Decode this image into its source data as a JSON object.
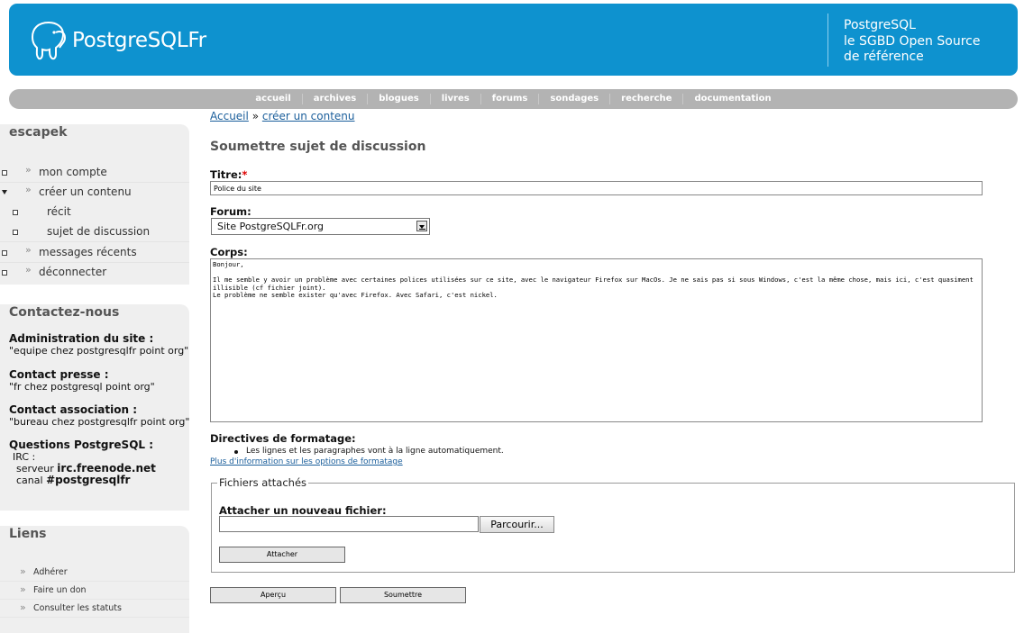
{
  "header": {
    "logo_text": "PostgreSQLFr",
    "tagline": [
      "PostgreSQL",
      "le SGBD Open Source",
      "de référence"
    ]
  },
  "nav": [
    "accueil",
    "archives",
    "blogues",
    "livres",
    "forums",
    "sondages",
    "recherche",
    "documentation"
  ],
  "sidebar": {
    "user_block": {
      "title": "escapek",
      "items": [
        {
          "label": "mon compte"
        },
        {
          "label": "créer un contenu"
        },
        {
          "label": "récit"
        },
        {
          "label": "sujet de discussion"
        },
        {
          "label": "messages récents"
        },
        {
          "label": "déconnecter"
        }
      ]
    },
    "contact_block": {
      "title": "Contactez-nous",
      "admin_heading": "Administration du site :",
      "admin_text": "\"equipe chez postgresqlfr point org\"",
      "press_heading": "Contact presse :",
      "press_text": "\"fr chez postgresql point org\"",
      "assoc_heading": "Contact association :",
      "assoc_text": "\"bureau chez postgresqlfr point org\"",
      "questions_heading": "Questions PostgreSQL :",
      "irc_label": "IRC :",
      "server_prefix": "serveur",
      "server_value": "irc.freenode.net",
      "channel_prefix": "canal",
      "channel_value": "#postgresqlfr"
    },
    "links_block": {
      "title": "Liens",
      "items": [
        "Adhérer",
        "Faire un don",
        "Consulter les statuts"
      ]
    }
  },
  "main": {
    "breadcrumb": {
      "home": "Accueil",
      "separator": "»",
      "current": "créer un contenu"
    },
    "page_title": "Soumettre sujet de discussion",
    "title_label": "Titre:",
    "title_required": "*",
    "title_value": "Police du site",
    "forum_label": "Forum:",
    "forum_selected": "Site PostgreSQLFr.org",
    "body_label": "Corps:",
    "body_value": "Bonjour,\n\nIl me semble y avoir un problème avec certaines polices utilisées sur ce site, avec le navigateur Firefox sur MacOs. Je ne sais pas si sous Windows, c'est la même chose, mais ici, c'est quasiment illisible (cf fichier joint).\nLe problème ne semble exister qu'avec Firefox. Avec Safari, c'est nickel.",
    "format_heading": "Directives de formatage:",
    "format_item": "Les lignes et les paragraphes vont à la ligne automatiquement.",
    "format_more_link": "Plus d'information sur les options de formatage",
    "files_legend": "Fichiers attachés",
    "attach_label": "Attacher un nouveau fichier:",
    "attach_value": "",
    "browse_button": "Parcourir...",
    "attach_button": "Attacher",
    "preview_button": "Aperçu",
    "submit_button": "Soumettre"
  }
}
